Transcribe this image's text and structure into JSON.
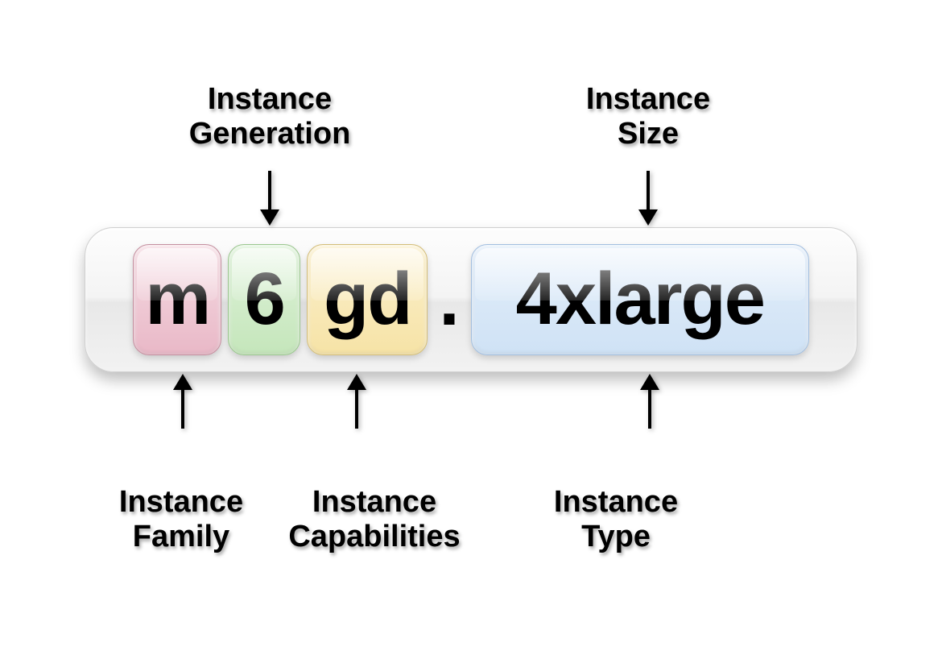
{
  "labels": {
    "top_generation": "Instance\nGeneration",
    "top_size": "Instance\nSize",
    "bottom_family": "Instance\nFamily",
    "bottom_capabilities": "Instance\nCapabilities",
    "bottom_type": "Instance\nType"
  },
  "segments": {
    "family": "m",
    "generation": "6",
    "capabilities": "gd",
    "separator": ".",
    "size": "4xlarge"
  },
  "colors": {
    "family": "#e9b8c7",
    "generation": "#c5e6bb",
    "capabilities": "#f6e3a6",
    "size": "#cfe2f5"
  }
}
